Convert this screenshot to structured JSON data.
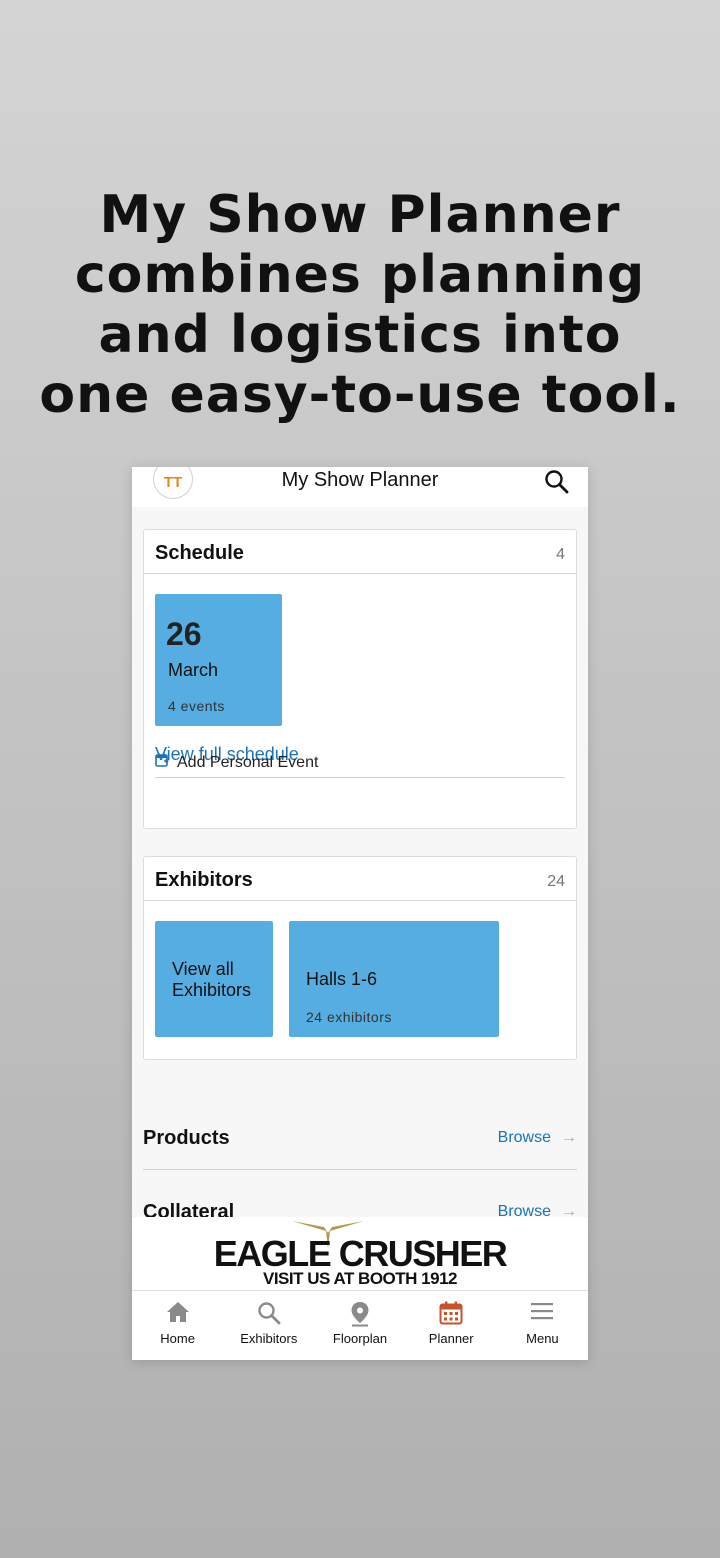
{
  "headline": {
    "line1": "My Show Planner",
    "line2": "combines planning",
    "line3": "and logistics into",
    "line4": "one easy-to-use tool."
  },
  "app": {
    "title": "My Show Planner",
    "avatar_initials": "TT",
    "accent_color": "#56ade2",
    "link_color": "#1a73b8"
  },
  "schedule": {
    "title": "Schedule",
    "count": "4",
    "date_tile": {
      "day": "26",
      "month": "March",
      "events": "4 events"
    },
    "view_full_link": "View full schedule",
    "add_personal_event": "Add Personal Event"
  },
  "exhibitors": {
    "title": "Exhibitors",
    "count": "24",
    "view_all_tile": {
      "line1": "View all",
      "line2": "Exhibitors"
    },
    "halls_tile": {
      "name": "Halls 1-6",
      "count": "24 exhibitors"
    }
  },
  "sections": [
    {
      "name": "Products",
      "action": "Browse"
    },
    {
      "name": "Collateral",
      "action": "Browse"
    }
  ],
  "banner": {
    "brand": "EAGLE CRUSHER",
    "tagline": "VISIT US AT BOOTH 1912"
  },
  "tabbar": [
    {
      "label": "Home",
      "icon": "home-icon",
      "active": false
    },
    {
      "label": "Exhibitors",
      "icon": "search-icon",
      "active": false
    },
    {
      "label": "Floorplan",
      "icon": "map-pin-icon",
      "active": false
    },
    {
      "label": "Planner",
      "icon": "calendar-icon",
      "active": true
    },
    {
      "label": "Menu",
      "icon": "menu-icon",
      "active": false
    }
  ]
}
